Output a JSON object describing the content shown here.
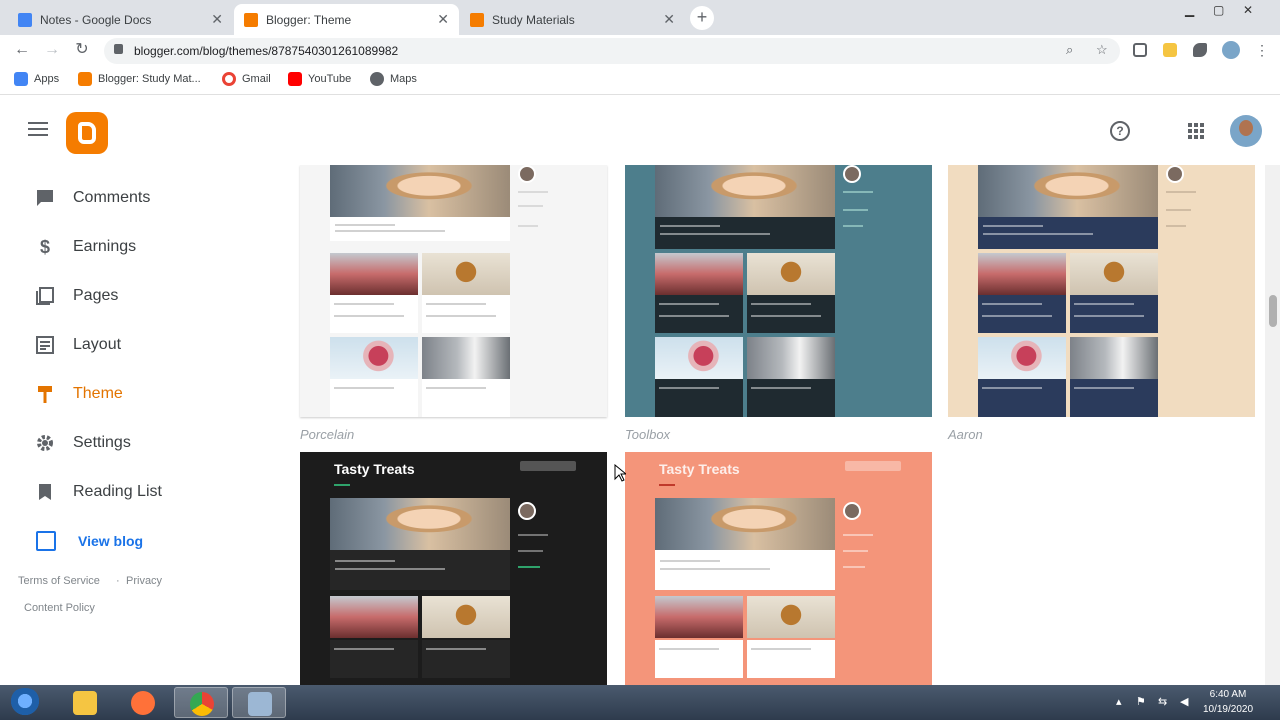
{
  "browser": {
    "tabs": [
      {
        "title": "Notes - Google Docs",
        "favicon_color": "#4285f4"
      },
      {
        "title": "Blogger: Theme",
        "favicon_color": "#f57c00"
      },
      {
        "title": "Study Materials",
        "favicon_color": "#f57c00"
      }
    ],
    "new_tab": "+",
    "url": "blogger.com/blog/themes/8787540301261089982",
    "bookmarks": [
      {
        "label": "Apps",
        "icon": "apps-grid-icon",
        "color": "#4285f4"
      },
      {
        "label": "Blogger: Study Mat...",
        "icon": "blogger-icon",
        "color": "#f57c00"
      },
      {
        "label": "Gmail",
        "icon": "google-icon",
        "color": "#ea4335"
      },
      {
        "label": "YouTube",
        "icon": "youtube-icon",
        "color": "#ff0000"
      },
      {
        "label": "Maps",
        "icon": "maps-icon",
        "color": "#5f6368"
      }
    ]
  },
  "app": {
    "brand_color": "#f57c00",
    "help_icon": "?",
    "sidebar": {
      "items": [
        {
          "label": "Comments",
          "icon": "comment-icon"
        },
        {
          "label": "Earnings",
          "icon": "dollar-icon"
        },
        {
          "label": "Pages",
          "icon": "pages-icon"
        },
        {
          "label": "Layout",
          "icon": "layout-icon"
        },
        {
          "label": "Theme",
          "icon": "paint-roller-icon",
          "active": true
        },
        {
          "label": "Settings",
          "icon": "gear-icon"
        },
        {
          "label": "Reading List",
          "icon": "bookmark-icon"
        }
      ],
      "view_blog": "View blog",
      "footer": {
        "terms": "Terms of Service",
        "sep": "·",
        "privacy": "Privacy",
        "content_policy": "Content Policy"
      }
    },
    "themes": [
      {
        "name": "Porcelain",
        "bg": "#f5f5f5",
        "card": "#ffffff",
        "text": "#9e9e9e"
      },
      {
        "name": "Toolbox",
        "bg": "#4d7e8c",
        "card": "#1f2a30",
        "text": "#ffffff"
      },
      {
        "name": "Aaron",
        "bg": "#f1dcc0",
        "card": "#2b3b5c",
        "text": "#ffffff"
      },
      {
        "name": "",
        "bg": "#1c1c1c",
        "card": "#262626",
        "text": "#ffffff",
        "blog_title": "Tasty Treats"
      },
      {
        "name": "",
        "bg": "#f4957a",
        "card": "#ffffff",
        "text": "#ffffff",
        "blog_title": "Tasty Treats"
      }
    ]
  },
  "taskbar": {
    "apps": [
      {
        "name": "file-explorer-icon",
        "color": "#f5c542"
      },
      {
        "name": "firefox-icon",
        "color": "#ff7139"
      },
      {
        "name": "chrome-icon",
        "color": "#4285f4",
        "active": true
      },
      {
        "name": "network-app-icon",
        "color": "#9cb7d4"
      }
    ],
    "time": "6:40 AM",
    "date": "10/19/2020"
  }
}
